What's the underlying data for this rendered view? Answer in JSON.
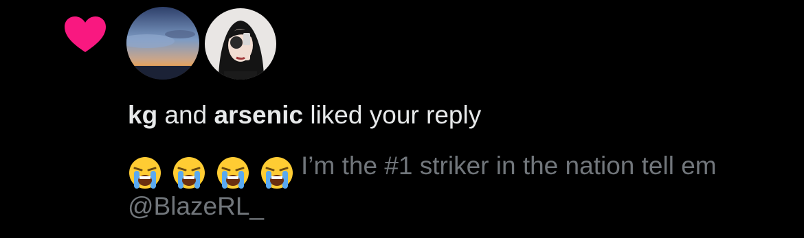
{
  "notification": {
    "type_icon": "heart-icon",
    "accent_color": "#f91880",
    "avatars": [
      {
        "name": "kg",
        "icon": "avatar-sky-sunset"
      },
      {
        "name": "arsenic",
        "icon": "avatar-person-with-camera"
      }
    ],
    "headline": {
      "user1": "kg",
      "connector": "and",
      "user2": "arsenic",
      "action": "liked your reply"
    },
    "reply": {
      "emojis": [
        "loudly-crying-face-emoji",
        "loudly-crying-face-emoji",
        "loudly-crying-face-emoji",
        "loudly-crying-face-emoji"
      ],
      "text": "I’m the #1 striker in the nation tell em @BlazeRL_"
    }
  }
}
